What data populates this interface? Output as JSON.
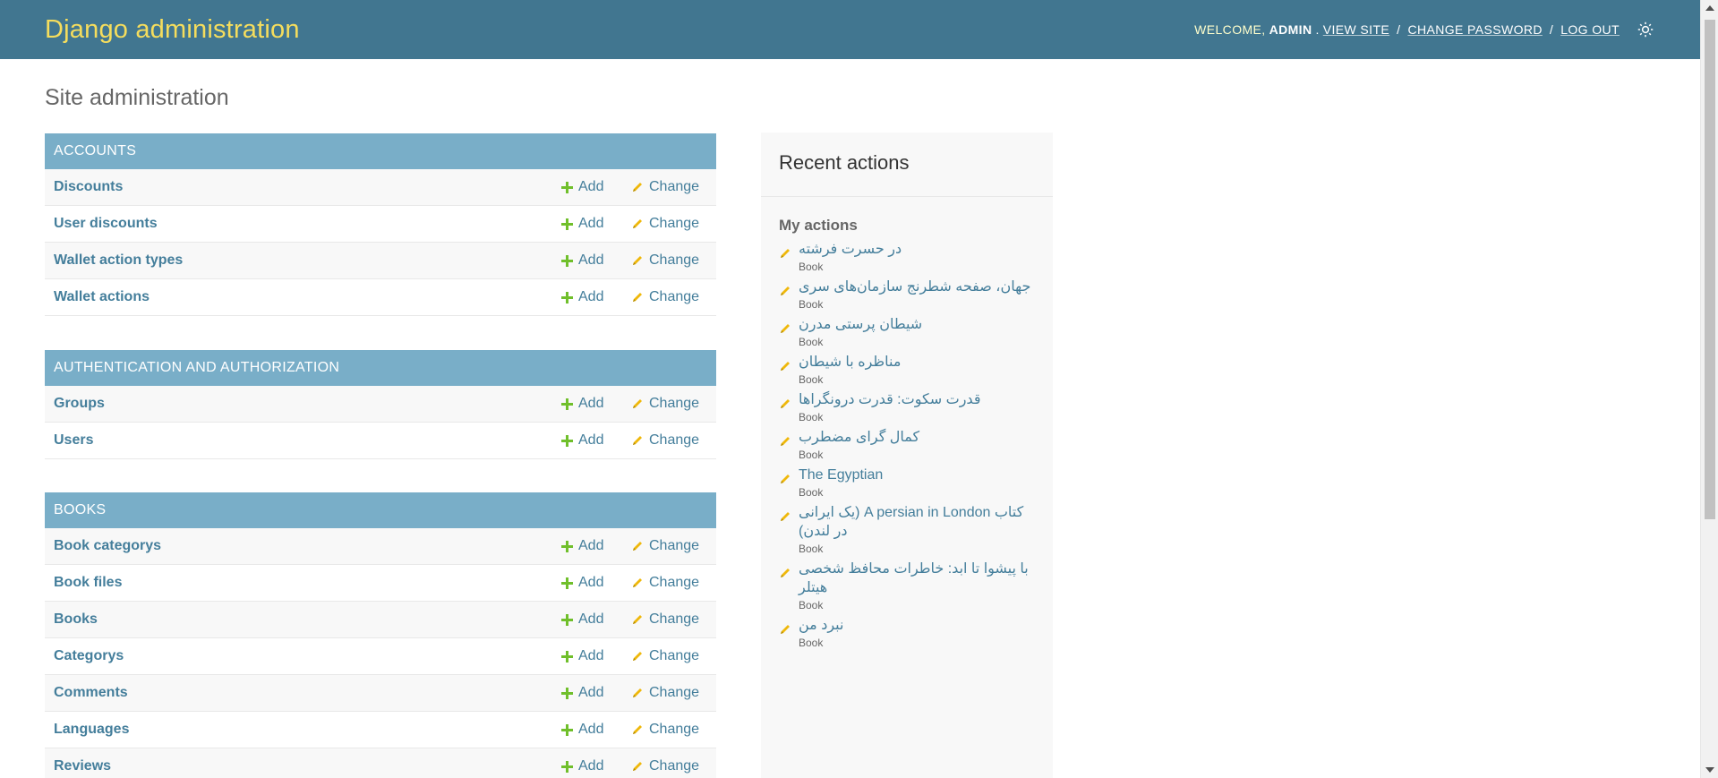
{
  "header": {
    "brand": "Django administration",
    "welcome_prefix": "WELCOME,",
    "user": "ADMIN",
    "view_site": "VIEW SITE",
    "change_password": "CHANGE PASSWORD",
    "log_out": "LOG OUT",
    "separator": "/",
    "theme_icon": "sun-icon"
  },
  "page_title": "Site administration",
  "actions": {
    "add_label": "Add",
    "change_label": "Change"
  },
  "modules": [
    {
      "caption": "Accounts",
      "models": [
        "Discounts",
        "User discounts",
        "Wallet action types",
        "Wallet actions"
      ]
    },
    {
      "caption": "Authentication and Authorization",
      "models": [
        "Groups",
        "Users"
      ]
    },
    {
      "caption": "Books",
      "models": [
        "Book categorys",
        "Book files",
        "Books",
        "Categorys",
        "Comments",
        "Languages",
        "Reviews"
      ]
    }
  ],
  "recent_actions": {
    "title": "Recent actions",
    "subtitle": "My actions",
    "items": [
      {
        "name": "در حسرت فرشته",
        "type": "Book"
      },
      {
        "name": "جهان، صفحه شطرنج سازمان‌های سری",
        "type": "Book"
      },
      {
        "name": "شیطان پرستی مدرن",
        "type": "Book"
      },
      {
        "name": "مناظره با شیطان",
        "type": "Book"
      },
      {
        "name": "قدرت سکوت: قدرت درونگراها",
        "type": "Book"
      },
      {
        "name": "کمال گرای مضطرب",
        "type": "Book"
      },
      {
        "name": "The Egyptian",
        "type": "Book"
      },
      {
        "name": "کتاب A persian in London (یک ایرانی در لندن)",
        "type": "Book"
      },
      {
        "name": "با پیشوا تا ابد: خاطرات محافظ شخصی هیتلر",
        "type": "Book"
      },
      {
        "name": "نبرد من",
        "type": "Book"
      }
    ]
  },
  "colors": {
    "header_bg": "#417690",
    "brand": "#f5dd5d",
    "caption_bg": "#79aec8",
    "link": "#447e9b",
    "add_icon": "#70bf2b",
    "change_icon": "#efb80b"
  }
}
